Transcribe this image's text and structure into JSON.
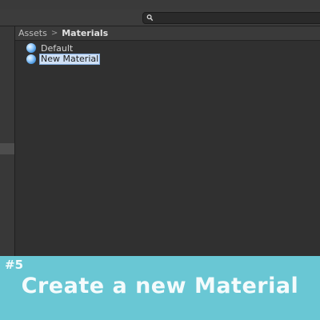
{
  "breadcrumb": {
    "items": [
      "Assets",
      "Materials"
    ],
    "separator": ">"
  },
  "assets": [
    {
      "name": "Default",
      "icon": "material-sphere-icon",
      "selected": false
    },
    {
      "name": "New Material",
      "icon": "material-sphere-icon",
      "selected": true
    }
  ],
  "banner": {
    "step": "#5",
    "title": "Create a new Material",
    "color": "#69c7d4"
  },
  "colors": {
    "background": "#282828",
    "selection": "#cfe0f5"
  }
}
